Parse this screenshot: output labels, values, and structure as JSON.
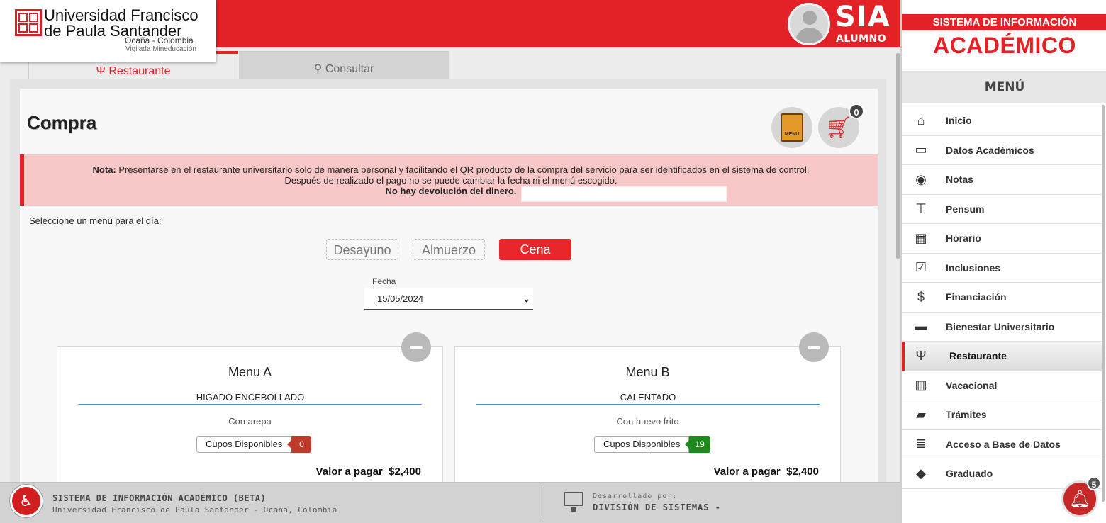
{
  "header": {
    "university_name_line1": "Universidad Francisco",
    "university_name_line2": "de Paula Santander",
    "university_location": "Ocaña - Colombia",
    "university_tagline": "Vigilada Mineducación",
    "app_name": "SIA",
    "app_role": "ALUMNO",
    "brand_color": "#e32227"
  },
  "tabs": [
    {
      "label": "Restaurante",
      "icon": "utensils-icon",
      "active": true
    },
    {
      "label": "Consultar",
      "icon": "search-icon",
      "active": false
    }
  ],
  "page": {
    "title": "Compra",
    "cart_count": "0",
    "menu_icon_label": "MENU"
  },
  "note": {
    "label": "Nota:",
    "line1": "Presentarse en el restaurante universitario solo de manera personal y facilitando el QR producto de la compra del servicio para ser identificados en el sistema de control.",
    "line2": "Después de realizado el pago no se puede cambiar la fecha ni el menú escogido.",
    "line3": "No hay devolución del dinero."
  },
  "selection": {
    "prompt": "Seleccione un menú para el día:",
    "meals": [
      "Desayuno",
      "Almuerzo",
      "Cena"
    ],
    "active_meal": "Cena",
    "date_label": "Fecha",
    "date_value": "15/05/2024"
  },
  "menus": [
    {
      "title": "Menu A",
      "dish": "HIGADO ENCEBOLLADO",
      "side": "Con arepa",
      "cupos_label": "Cupos Disponibles",
      "cupos": "0",
      "cupos_color": "#c0392b",
      "valor_label": "Valor a pagar",
      "valor": "$2,400"
    },
    {
      "title": "Menu B",
      "dish": "CALENTADO",
      "side": "Con huevo frito",
      "cupos_label": "Cupos Disponibles",
      "cupos": "19",
      "cupos_color": "#1e8a1e",
      "valor_label": "Valor a pagar",
      "valor": "$2,400"
    }
  ],
  "sidebar": {
    "brand_top": "SISTEMA DE INFORMACIÓN",
    "brand_main": "ACADÉMICO",
    "menu_title": "MENÚ",
    "items": [
      {
        "label": "Inicio",
        "icon": "home-icon",
        "glyph": "⌂"
      },
      {
        "label": "Datos Académicos",
        "icon": "id-card-icon",
        "glyph": "▭"
      },
      {
        "label": "Notas",
        "icon": "medal-icon",
        "glyph": "◉"
      },
      {
        "label": "Pensum",
        "icon": "sitemap-icon",
        "glyph": "⊤"
      },
      {
        "label": "Horario",
        "icon": "calendar-icon",
        "glyph": "▦"
      },
      {
        "label": "Inclusiones",
        "icon": "checkbox-icon",
        "glyph": "☑"
      },
      {
        "label": "Financiación",
        "icon": "dollar-icon",
        "glyph": "$"
      },
      {
        "label": "Bienestar Universitario",
        "icon": "briefcase-icon",
        "glyph": "▬"
      },
      {
        "label": "Restaurante",
        "icon": "utensils-icon",
        "glyph": "Ψ",
        "active": true
      },
      {
        "label": "Vacacional",
        "icon": "books-icon",
        "glyph": "▥"
      },
      {
        "label": "Trámites",
        "icon": "folder-icon",
        "glyph": "▰"
      },
      {
        "label": "Acceso a Base de Datos",
        "icon": "database-icon",
        "glyph": "≣"
      },
      {
        "label": "Graduado",
        "icon": "graduation-cap-icon",
        "glyph": "◆"
      }
    ]
  },
  "notifications": {
    "count": "5"
  },
  "footer": {
    "title": "SISTEMA DE INFORMACIÓN ACADÉMICO (BETA)",
    "subtitle": "Universidad Francisco de Paula Santander - Ocaña, Colombia",
    "dev_label": "Desarrollado por:",
    "dev_name": "DIVISIÓN DE SISTEMAS -"
  }
}
